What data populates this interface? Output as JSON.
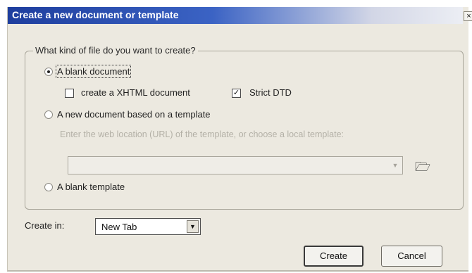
{
  "dialog": {
    "title": "Create a new document or template",
    "close_glyph": "×",
    "group_label": "What kind of file do you want to create?",
    "options": {
      "blank_document": {
        "label": "A blank document",
        "selected": true
      },
      "xhtml": {
        "label": "create a XHTML document",
        "checked": false
      },
      "strict_dtd": {
        "label": "Strict DTD",
        "checked": true,
        "check_glyph": "✓"
      },
      "from_template": {
        "label": "A new document based on a template",
        "selected": false
      },
      "template_hint": "Enter the web location (URL) of the template, or choose a local template:",
      "template_url": {
        "value": "",
        "enabled": false
      },
      "blank_template": {
        "label": "A blank template",
        "selected": false
      }
    },
    "create_in": {
      "label": "Create in:",
      "value": "New Tab"
    },
    "buttons": {
      "create": "Create",
      "cancel": "Cancel"
    },
    "icons": {
      "close": "close-icon",
      "folder": "open-folder-icon",
      "dropdown": "chevron-down-icon"
    },
    "colors": {
      "titlebar_start": "#1e3e9e",
      "titlebar_end": "#eceef4",
      "face": "#ece9e0"
    }
  }
}
